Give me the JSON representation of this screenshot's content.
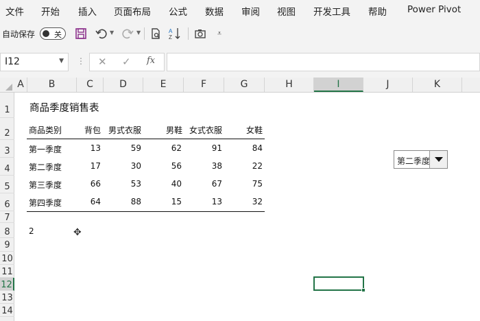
{
  "menu": [
    "文件",
    "开始",
    "插入",
    "页面布局",
    "公式",
    "数据",
    "审阅",
    "视图",
    "开发工具",
    "帮助",
    "Power Pivot"
  ],
  "qat": {
    "autosave_label": "自动保存",
    "toggle_state": "关"
  },
  "formula_bar": {
    "name_box": "I12",
    "fx_label": "fx",
    "value": ""
  },
  "columns": [
    "A",
    "B",
    "C",
    "D",
    "E",
    "F",
    "G",
    "H",
    "I",
    "J",
    "K"
  ],
  "selected_column": "I",
  "rows": [
    "1",
    "2",
    "3",
    "4",
    "5",
    "6",
    "7",
    "8",
    "9",
    "10",
    "11",
    "12",
    "13",
    "14"
  ],
  "selected_row": "12",
  "sheet": {
    "title": "商品季度销售表",
    "headers": [
      "商品类别",
      "背包",
      "男式衣服",
      "男鞋",
      "女式衣服",
      "女鞋"
    ],
    "data": [
      [
        "第一季度",
        "13",
        "59",
        "62",
        "91",
        "84"
      ],
      [
        "第二季度",
        "17",
        "30",
        "56",
        "38",
        "22"
      ],
      [
        "第三季度",
        "66",
        "53",
        "40",
        "67",
        "75"
      ],
      [
        "第四季度",
        "64",
        "88",
        "15",
        "13",
        "32"
      ]
    ],
    "b8_value": "2"
  },
  "combo": {
    "selected": "第二季度"
  },
  "colors": {
    "accent": "#217346",
    "ribbon_bg": "#f3f3f3"
  }
}
